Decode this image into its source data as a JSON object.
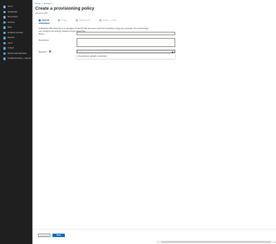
{
  "sidebar": {
    "items": [
      {
        "label": "Home",
        "icon": "home-icon",
        "color": "#8ab4f8"
      },
      {
        "label": "Dashboard",
        "icon": "dashboard-icon",
        "color": "#4fc3f7"
      },
      {
        "label": "All services",
        "icon": "all-services-icon",
        "color": "#9fa8da"
      },
      {
        "label": "Devices",
        "icon": "devices-icon",
        "color": "#4fc3f7"
      },
      {
        "label": "Apps",
        "icon": "apps-icon",
        "color": "#4fc3f7"
      },
      {
        "label": "Endpoint security",
        "icon": "endpoint-security-icon",
        "color": "#4fc3f7"
      },
      {
        "label": "Reports",
        "icon": "reports-icon",
        "color": "#64b5f6"
      },
      {
        "label": "Users",
        "icon": "users-icon",
        "color": "#64b5f6"
      },
      {
        "label": "Groups",
        "icon": "groups-icon",
        "color": "#64b5f6"
      },
      {
        "label": "Tenant administration",
        "icon": "tenant-administration-icon",
        "color": "#64b5f6"
      },
      {
        "label": "Troubleshooting + support",
        "icon": "troubleshooting-icon",
        "color": "#64b5f6"
      }
    ]
  },
  "breadcrumb": {
    "items": [
      "Home",
      "Devices"
    ],
    "separator": ">"
  },
  "header": {
    "title": "Create a provisioning policy",
    "subtitle": "Windows 365",
    "more_label": "..."
  },
  "steps": [
    {
      "label": "General",
      "current": true
    },
    {
      "label": "Image",
      "current": false
    },
    {
      "label": "Assignments",
      "current": false
    },
    {
      "label": "Review + create",
      "current": false
    }
  ],
  "form": {
    "intro": "A Windows 365 Cloud PC is a managed virtual PC that lets users work from anywhere using any computer. The wizard helps you configure the settings needed to host Cloud PCs.",
    "name_label": "Name",
    "description_label": "Description",
    "network_label": "Network",
    "required_marker": "*",
    "info_glyph": "i",
    "name_value": "",
    "description_value": "",
    "network_selected": "",
    "network_options": [
      "On-premises network connection"
    ]
  },
  "footer": {
    "previous_label": "Previous",
    "next_label": "Next"
  },
  "colors": {
    "accent": "#0f6cbd",
    "sidebar_bg": "#1f1f1f",
    "required": "#a4262c"
  }
}
